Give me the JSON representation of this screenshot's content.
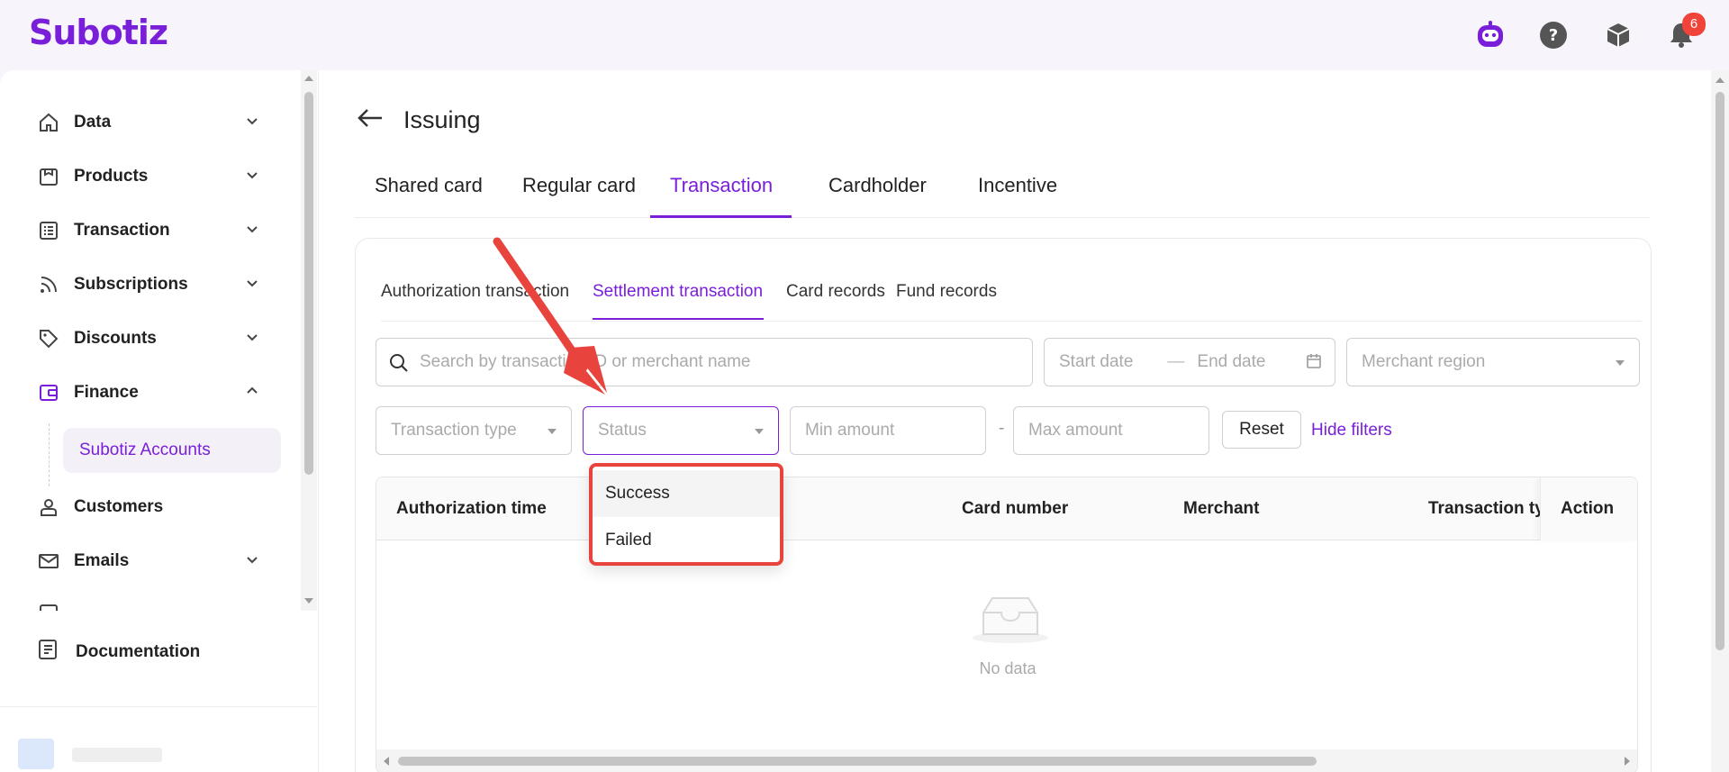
{
  "app": {
    "brand": "Subotiz",
    "notification_count": "6"
  },
  "colors": {
    "accent": "#7a1fd9",
    "highlight": "#e8433d"
  },
  "topbar": {
    "icons": [
      "bot-icon",
      "help-icon",
      "box-icon",
      "bell-icon"
    ]
  },
  "sidebar": {
    "items": [
      {
        "label": "Data",
        "icon": "home-icon"
      },
      {
        "label": "Products",
        "icon": "shop-icon"
      },
      {
        "label": "Transaction",
        "icon": "list-icon"
      },
      {
        "label": "Subscriptions",
        "icon": "rss-icon"
      },
      {
        "label": "Discounts",
        "icon": "tag-icon"
      },
      {
        "label": "Finance",
        "icon": "wallet-icon"
      },
      {
        "label": "Customers",
        "icon": "user-icon"
      },
      {
        "label": "Emails",
        "icon": "mail-icon"
      }
    ],
    "finance_sub": "Subotiz Accounts",
    "documentation": "Documentation"
  },
  "page": {
    "title": "Issuing",
    "tabs": [
      "Shared card",
      "Regular card",
      "Transaction",
      "Cardholder",
      "Incentive"
    ],
    "active_tab": "Transaction",
    "subtabs": [
      "Authorization transaction",
      "Settlement transaction",
      "Card records",
      "Fund records"
    ],
    "active_subtab": "Settlement transaction"
  },
  "filters": {
    "search_placeholder": "Search by transaction ID or merchant name",
    "start_date": "Start date",
    "date_sep": "—",
    "end_date": "End date",
    "merchant_region": "Merchant region",
    "transaction_type": "Transaction type",
    "status": "Status",
    "min_amount": "Min amount",
    "range_sep": "-",
    "max_amount": "Max amount",
    "reset": "Reset",
    "hide_filters": "Hide filters"
  },
  "status_options": [
    "Success",
    "Failed"
  ],
  "table": {
    "columns": [
      "Authorization time",
      "Card number",
      "Merchant",
      "Transaction typ",
      "Action"
    ],
    "empty_text": "No data"
  }
}
